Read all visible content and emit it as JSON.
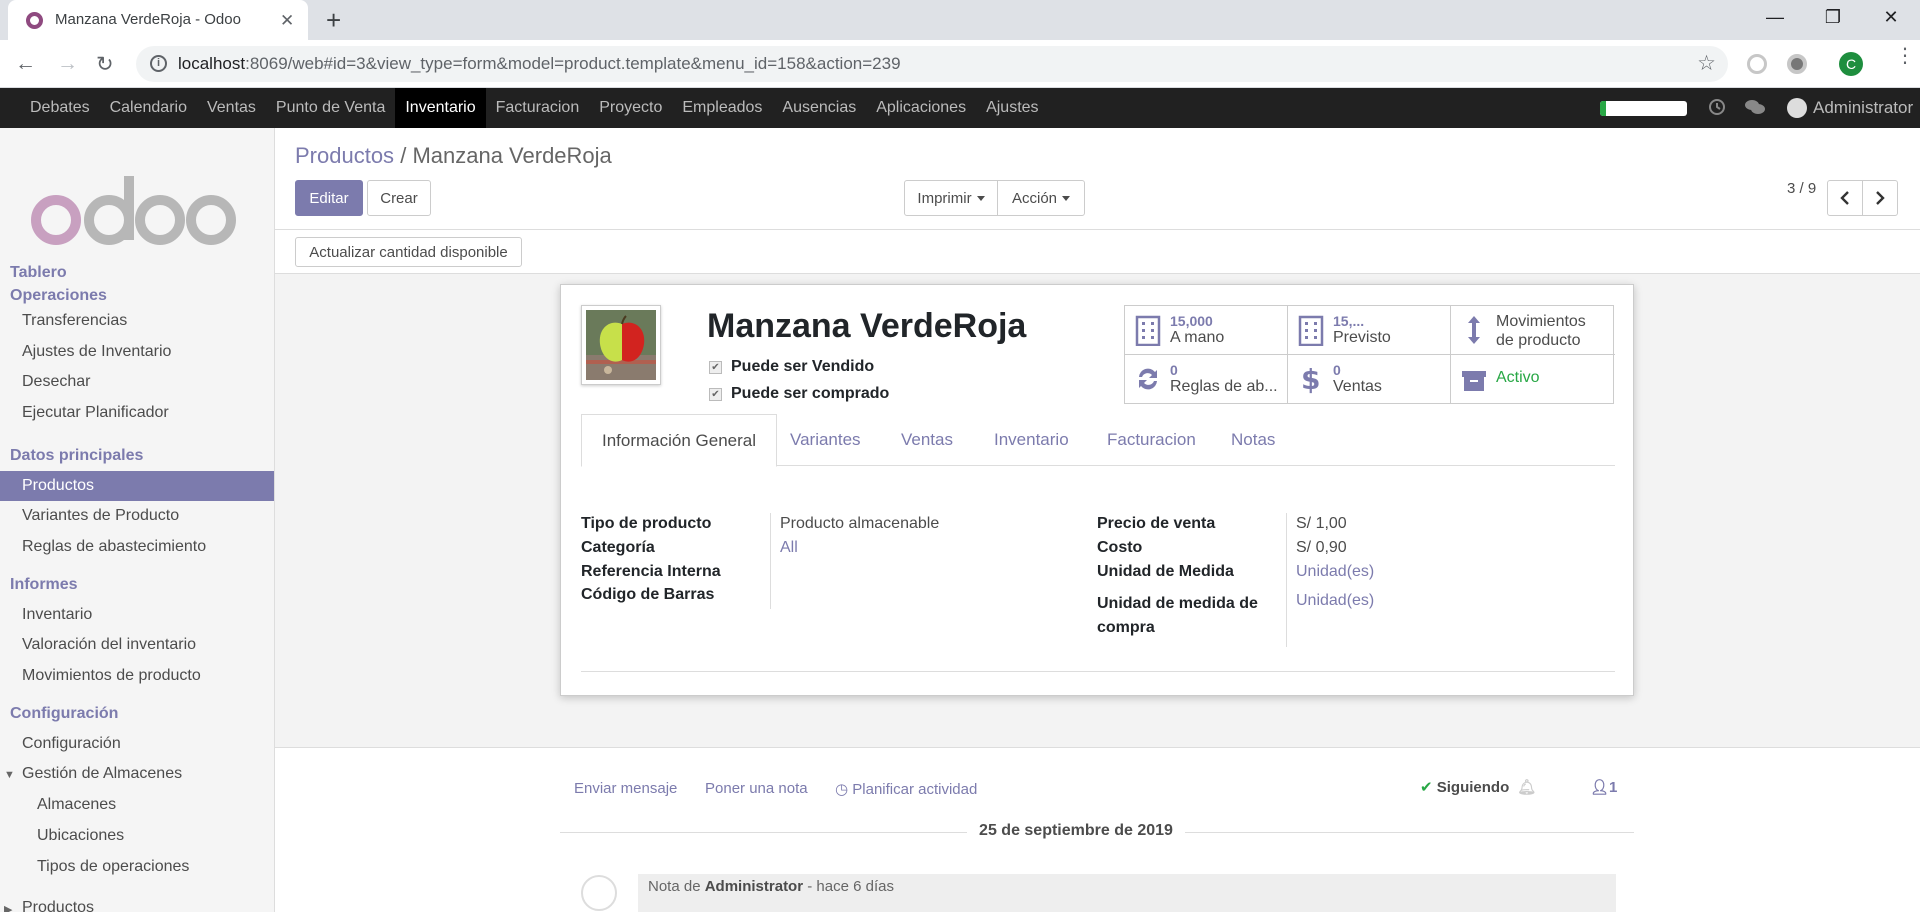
{
  "browser": {
    "tab_title": "Manzana VerdeRoja - Odoo",
    "url_host": "localhost",
    "url_rest": ":8069/web#id=3&view_type=form&model=product.template&menu_id=158&action=239",
    "profile_initial": "C"
  },
  "topmenu": {
    "items": [
      "Debates",
      "Calendario",
      "Ventas",
      "Punto de Venta",
      "Inventario",
      "Facturacion",
      "Proyecto",
      "Empleados",
      "Ausencias",
      "Aplicaciones",
      "Ajustes"
    ],
    "active": "Inventario",
    "user": "Administrator",
    "progress": 0.07
  },
  "sidebar": {
    "logo_text": "odoo",
    "cat_tablero": "Tablero",
    "cat_operaciones": "Operaciones",
    "op_items": [
      "Transferencias",
      "Ajustes de Inventario",
      "Desechar",
      "Ejecutar Planificador"
    ],
    "cat_datos": "Datos principales",
    "datos_items": [
      "Productos",
      "Variantes de Producto",
      "Reglas de abastecimiento"
    ],
    "cat_informes": "Informes",
    "informes_items": [
      "Inventario",
      "Valoración del inventario",
      "Movimientos de producto"
    ],
    "cat_config": "Configuración",
    "config_items": [
      "Configuración",
      "Gestión de Almacenes",
      "Almacenes",
      "Ubicaciones",
      "Tipos de operaciones",
      "Productos"
    ]
  },
  "control_panel": {
    "breadcrumb_root": "Productos",
    "breadcrumb_sep": "/",
    "breadcrumb_current": "Manzana VerdeRoja",
    "edit": "Editar",
    "create": "Crear",
    "print": "Imprimir",
    "action": "Acción",
    "pager": "3 / 9",
    "update_qty": "Actualizar cantidad disponible"
  },
  "product": {
    "name": "Manzana VerdeRoja",
    "sale_ok": "Puede ser Vendido",
    "purchase_ok": "Puede ser comprado"
  },
  "smart_buttons": {
    "on_hand_value": "15,000",
    "on_hand_label": "A mano",
    "forecast_value": "15,...",
    "forecast_label": "Previsto",
    "moves_label_1": "Movimientos",
    "moves_label_2": "de producto",
    "rules_value": "0",
    "rules_label": "Reglas de ab...",
    "sales_value": "0",
    "sales_label": "Ventas",
    "active_label": "Activo"
  },
  "tabs": [
    "Información General",
    "Variantes",
    "Ventas",
    "Inventario",
    "Facturacion",
    "Notas"
  ],
  "fields": {
    "type_label": "Tipo de producto",
    "type_value": "Producto almacenable",
    "categ_label": "Categoría",
    "categ_value": "All",
    "ref_label": "Referencia Interna",
    "barcode_label": "Código de Barras",
    "price_label": "Precio de venta",
    "price_value": "S/ 1,00",
    "cost_label": "Costo",
    "cost_value": "S/ 0,90",
    "uom_label": "Unidad de Medida",
    "uom_value": "Unidad(es)",
    "uom_po_label_1": "Unidad de medida de",
    "uom_po_label_2": "compra",
    "uom_po_value": "Unidad(es)"
  },
  "chatter": {
    "send_message": "Enviar mensaje",
    "log_note": "Poner una nota",
    "schedule": "Planificar actividad",
    "following": "Siguiendo",
    "followers": "1",
    "date": "25 de septiembre de 2019",
    "note_prefix": "Nota de",
    "note_author": "Administrator",
    "note_time": "- hace 6 días"
  },
  "colors": {
    "brand": "#7c7bad",
    "topbar": "#212121",
    "success": "#28a745"
  }
}
